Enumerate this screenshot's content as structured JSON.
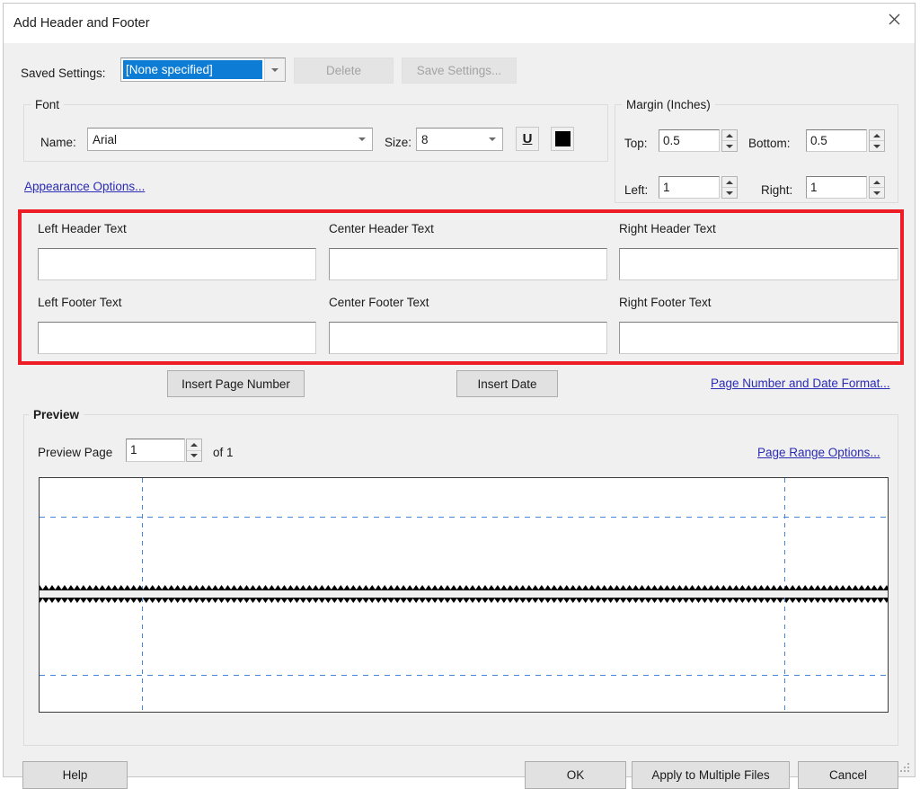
{
  "window": {
    "title": "Add Header and Footer",
    "close_icon": "close-icon"
  },
  "saved_settings": {
    "label": "Saved Settings:",
    "value": "[None specified]",
    "dropdown_icon": "chevron-down-icon",
    "delete_label": "Delete",
    "save_label": "Save Settings..."
  },
  "font": {
    "group_title": "Font",
    "name_label": "Name:",
    "name_value": "Arial",
    "name_dropdown_icon": "chevron-down-icon",
    "size_label": "Size:",
    "size_value": "8",
    "size_dropdown_icon": "chevron-down-icon",
    "underline_icon": "underline-icon",
    "underline_glyph": "U",
    "color_icon": "text-color-swatch-icon",
    "color_value": "#000000",
    "appearance_link": "Appearance Options..."
  },
  "margin": {
    "group_title": "Margin (Inches)",
    "top_label": "Top:",
    "top_value": "0.5",
    "bottom_label": "Bottom:",
    "bottom_value": "0.5",
    "left_label": "Left:",
    "left_value": "1",
    "right_label": "Right:",
    "right_value": "1",
    "spinner_up_icon": "triangle-up-icon",
    "spinner_down_icon": "triangle-down-icon"
  },
  "header_footer": {
    "highlight_color": "#ee1c25",
    "left_header_label": "Left Header Text",
    "left_header_value": "",
    "center_header_label": "Center Header Text",
    "center_header_value": "",
    "right_header_label": "Right Header Text",
    "right_header_value": "",
    "left_footer_label": "Left Footer Text",
    "left_footer_value": "",
    "center_footer_label": "Center Footer Text",
    "center_footer_value": "",
    "right_footer_label": "Right Footer Text",
    "right_footer_value": ""
  },
  "insert_row": {
    "page_number_label": "Insert Page Number",
    "date_label": "Insert Date",
    "format_link": "Page Number and Date Format..."
  },
  "preview": {
    "group_title": "Preview",
    "page_label": "Preview Page",
    "page_value": "1",
    "of_label": "of 1",
    "range_link": "Page Range Options...",
    "guide_color": "#4a86d8"
  },
  "footer_buttons": {
    "help_label": "Help",
    "ok_label": "OK",
    "apply_multiple_label": "Apply to Multiple Files",
    "cancel_label": "Cancel"
  }
}
